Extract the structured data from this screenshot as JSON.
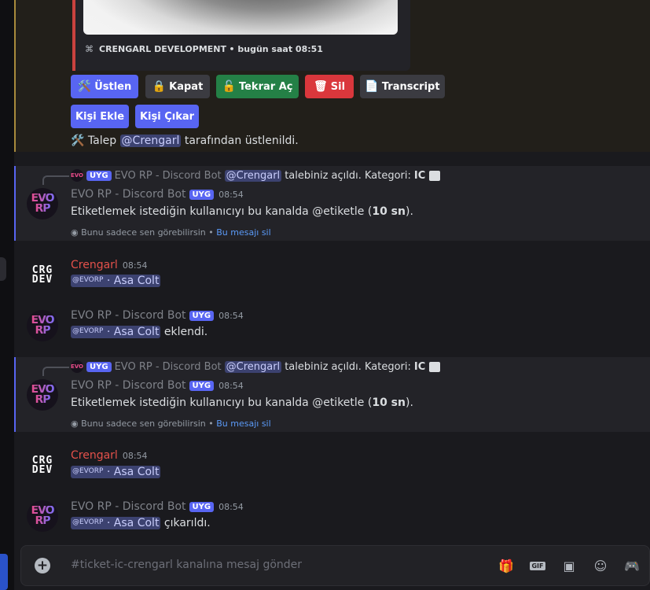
{
  "embed": {
    "footer_author": "CRENGARL DEVELOPMENT",
    "footer_time": "• bugün saat 08:51"
  },
  "buttons_row1": [
    {
      "icon": "🛠️",
      "label": "Üstlen"
    },
    {
      "icon": "🔒",
      "label": "Kapat"
    },
    {
      "icon": "🔓",
      "label": "Tekrar Aç"
    },
    {
      "icon": "🗑",
      "label": "Sil"
    },
    {
      "icon": "📄",
      "label": "Transcript"
    }
  ],
  "buttons_row2": [
    {
      "label": "Kişi Ekle"
    },
    {
      "label": "Kişi Çıkar"
    }
  ],
  "claim_line": {
    "icon": "🛠️",
    "prefix": "Talep",
    "mention": "@Crengarl",
    "suffix": "tarafından üstlenildi."
  },
  "messages": [
    {
      "reply": {
        "tag": "UYG",
        "name": "EVO RP - Discord Bot",
        "mention": "@Crengarl",
        "text": "talebiniz açıldı. Kategori:",
        "category": "IC",
        "image_icon": "image-icon"
      },
      "author": "EVO RP - Discord Bot",
      "tag": "UYG",
      "time": "08:54",
      "text_pre": "Etiketlemek istediğin kullanıcıyı bu kanalda @etiketle (",
      "text_bold": "10 sn",
      "text_post": ").",
      "ephemeral_note": "Bunu sadece sen görebilirsin •",
      "dismiss": "Bu mesajı sil"
    },
    {
      "author": "Crengarl",
      "time": "08:54",
      "mention_tag": "@EVORP",
      "mention_name": "· Asa Colt",
      "suffix": ""
    },
    {
      "author": "EVO RP - Discord Bot",
      "tag": "UYG",
      "time": "08:54",
      "mention_tag": "@EVORP",
      "mention_name": "· Asa Colt",
      "suffix": "eklendi."
    },
    {
      "reply": {
        "tag": "UYG",
        "name": "EVO RP - Discord Bot",
        "mention": "@Crengarl",
        "text": "talebiniz açıldı. Kategori:",
        "category": "IC",
        "image_icon": "image-icon"
      },
      "author": "EVO RP - Discord Bot",
      "tag": "UYG",
      "time": "08:54",
      "text_pre": "Etiketlemek istediğin kullanıcıyı bu kanalda @etiketle (",
      "text_bold": "10 sn",
      "text_post": ").",
      "ephemeral_note": "Bunu sadece sen görebilirsin •",
      "dismiss": "Bu mesajı sil"
    },
    {
      "author": "Crengarl",
      "time": "08:54",
      "mention_tag": "@EVORP",
      "mention_name": "· Asa Colt",
      "suffix": ""
    },
    {
      "author": "EVO RP - Discord Bot",
      "tag": "UYG",
      "time": "08:54",
      "mention_tag": "@EVORP",
      "mention_name": "· Asa Colt",
      "suffix": "çıkarıldı."
    }
  ],
  "avatars": {
    "bot_line1": "EVO",
    "bot_line2": "RP",
    "user_line1": "CRG",
    "user_line2": "DEV"
  },
  "input": {
    "placeholder": "#ticket-ic-crengarl kanalına mesaj gönder",
    "plus": "+",
    "gif": "GIF"
  },
  "colors": {
    "accent": "#5865f2",
    "crengarl": "#e4514b",
    "link": "#5b9af8"
  }
}
